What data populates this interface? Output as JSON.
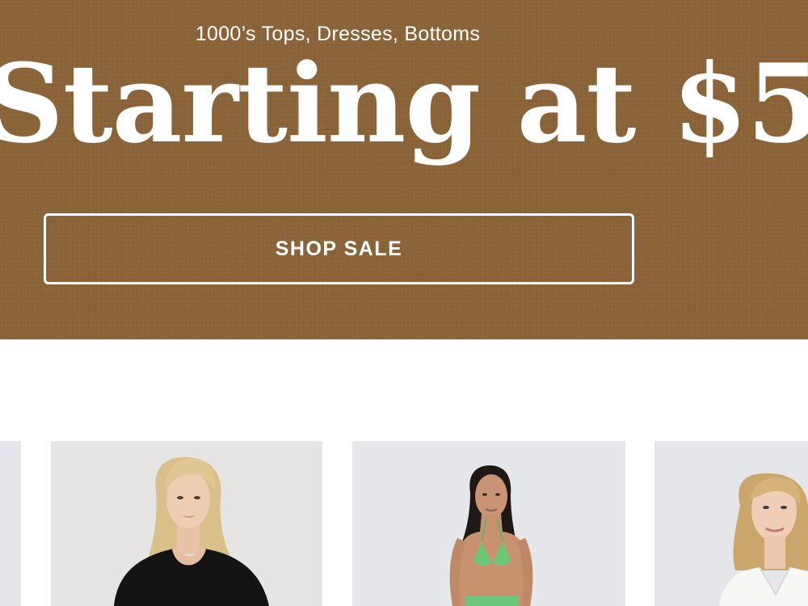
{
  "hero": {
    "subtitle": "1000’s Tops, Dresses, Bottoms",
    "headline": "Starting at $5",
    "cta_label": "SHOP SALE",
    "background_color": "#8b6338",
    "text_color": "#ffffff"
  },
  "products": {
    "cards": [
      {
        "image_icon": "product-image-partial"
      },
      {
        "image_icon": "model-black-top"
      },
      {
        "image_icon": "model-green-bikini"
      },
      {
        "image_icon": "model-white-top"
      }
    ]
  }
}
